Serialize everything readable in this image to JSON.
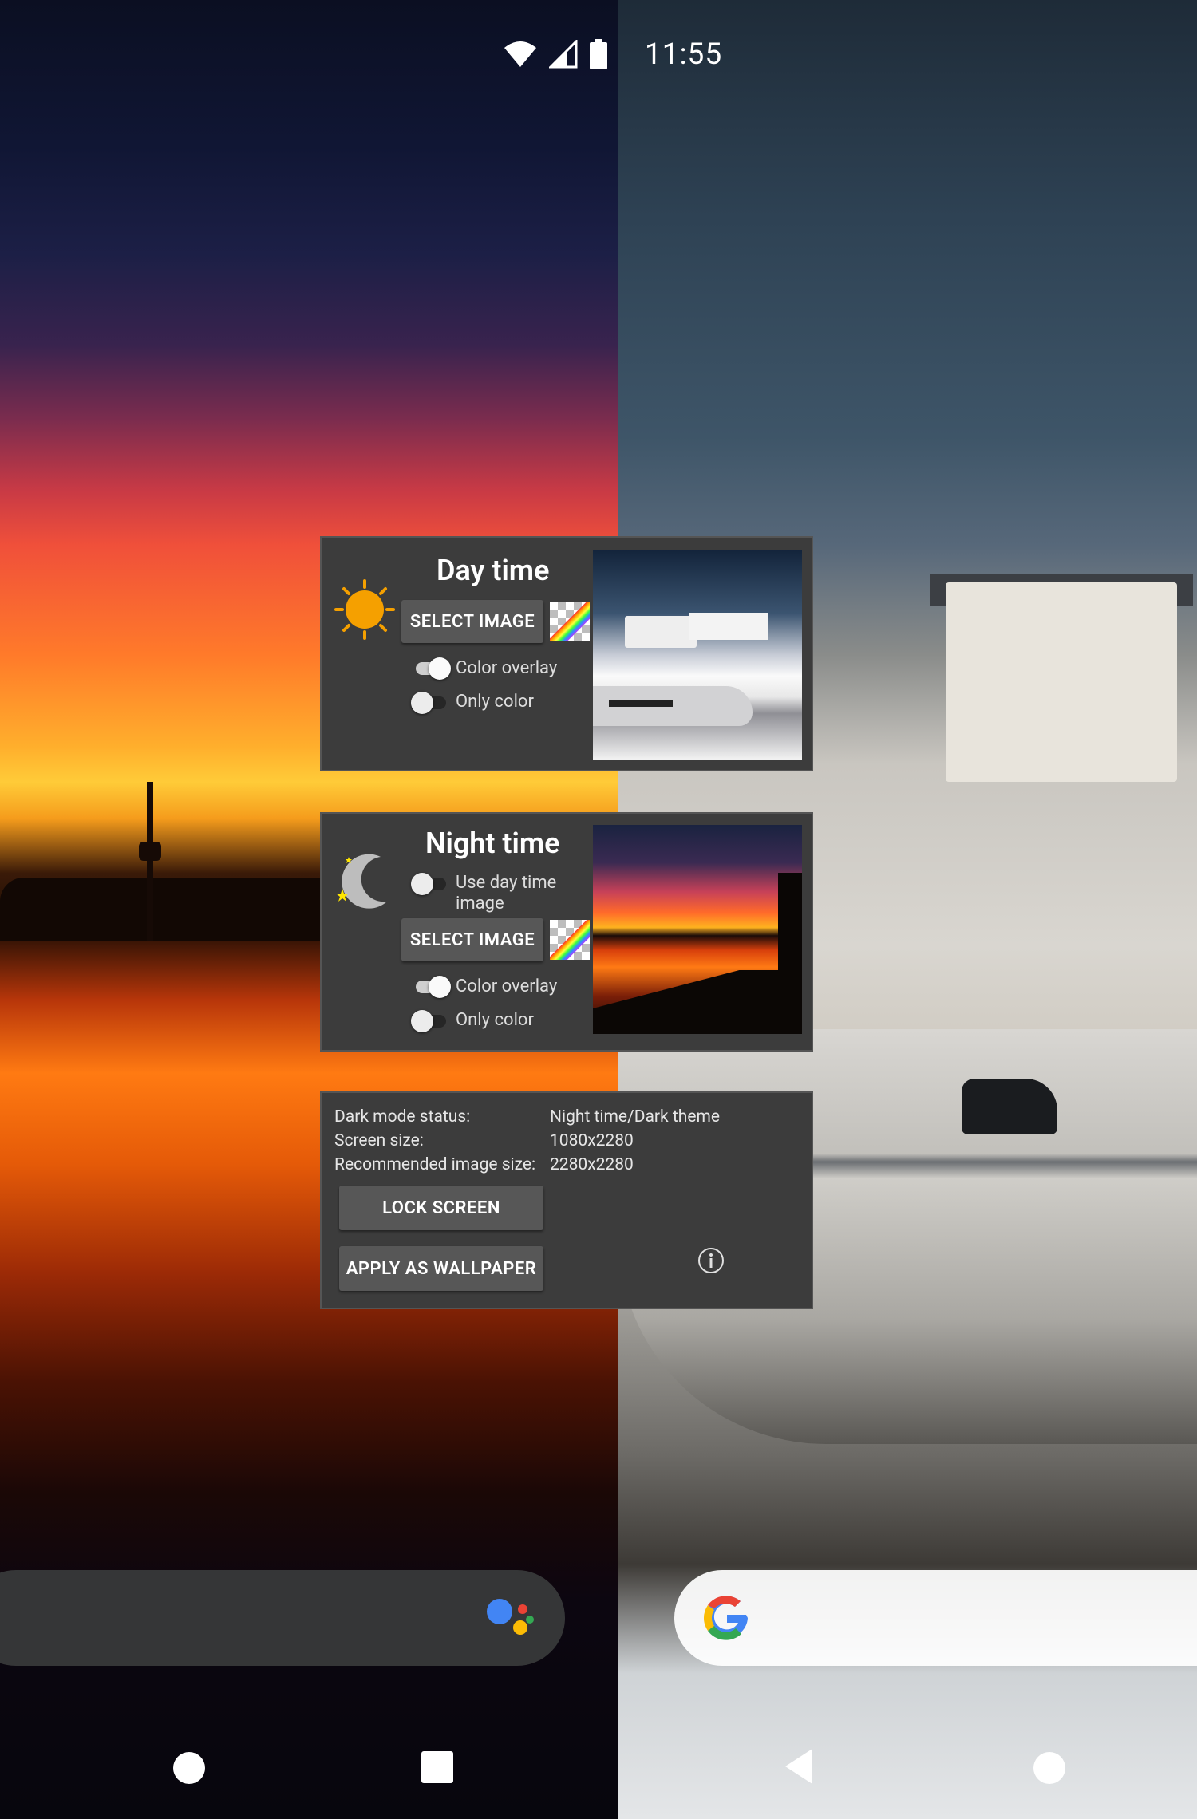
{
  "status_bar": {
    "time": "11:55",
    "icons": [
      "wifi-icon",
      "signal-icon",
      "battery-icon"
    ]
  },
  "day_card": {
    "title": "Day time",
    "icon": "sun-icon",
    "select_image_label": "SELECT IMAGE",
    "color_overlay_label": "Color overlay",
    "color_overlay_on": true,
    "only_color_label": "Only color",
    "only_color_on": false
  },
  "night_card": {
    "title": "Night time",
    "icon": "moon-icon",
    "use_day_label_line1": "Use day time",
    "use_day_label_line2": "image",
    "use_day_on": false,
    "select_image_label": "SELECT IMAGE",
    "color_overlay_label": "Color overlay",
    "color_overlay_on": true,
    "only_color_label": "Only color",
    "only_color_on": false
  },
  "info_card": {
    "rows": [
      {
        "label": "Dark mode status:",
        "value": "Night time/Dark theme"
      },
      {
        "label": "Screen size:",
        "value": "1080x2280"
      },
      {
        "label": "Recommended image size:",
        "value": "2280x2280"
      }
    ],
    "lock_screen_label": "LOCK SCREEN",
    "apply_wallpaper_label": "APPLY AS WALLPAPER",
    "info_icon": "info-icon"
  },
  "dock": {
    "assistant_icon": "google-assistant-icon",
    "search_icon": "google-g-icon"
  },
  "nav_bar": {
    "left_buttons": [
      "home-icon",
      "recents-icon"
    ],
    "right_buttons": [
      "back-icon",
      "home-icon"
    ]
  },
  "colors": {
    "card_bg": "#3c3c3c",
    "button_bg": "#575757",
    "sun": "#f5a000",
    "moon": "#bdbdbd"
  }
}
